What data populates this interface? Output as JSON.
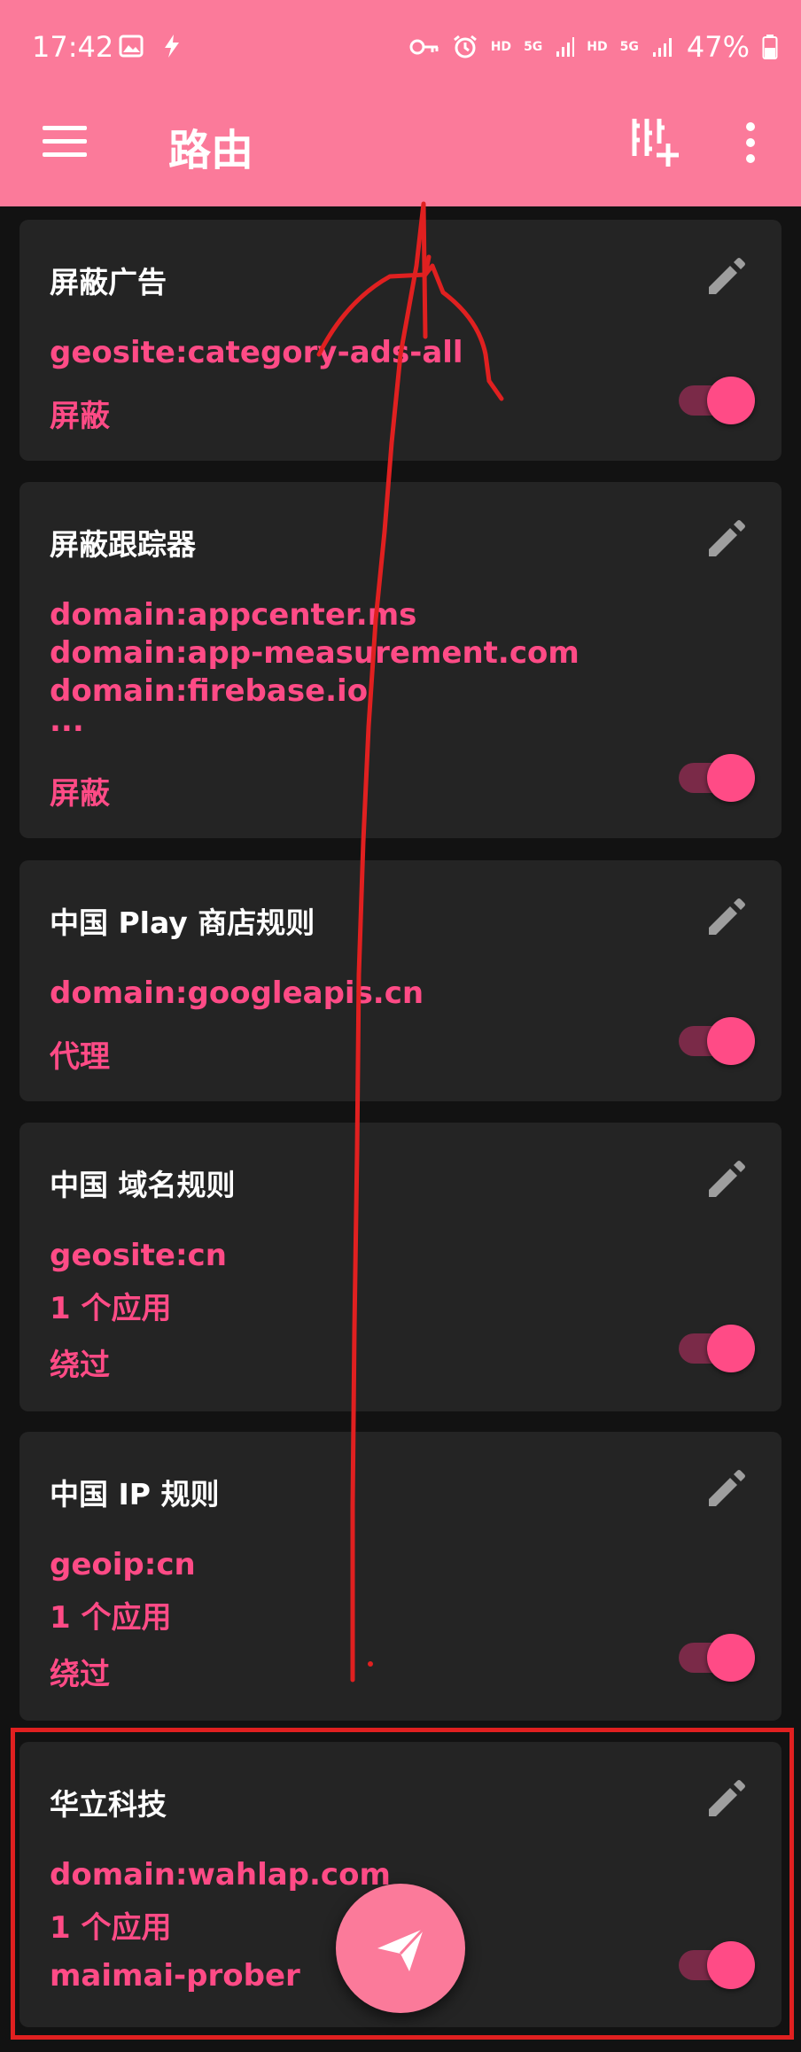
{
  "status_bar": {
    "time": "17:42",
    "battery": "47%",
    "network_labels": [
      "HD",
      "5G",
      "HD",
      "5G"
    ],
    "icons": [
      "image-icon",
      "bolt-icon",
      "key-icon",
      "alarm-icon",
      "signal-icon",
      "signal-icon",
      "battery-icon"
    ]
  },
  "app_bar": {
    "title": "路由",
    "icons": [
      "menu-icon",
      "add-column-icon",
      "more-vert-icon"
    ]
  },
  "colors": {
    "app_bar": "#fb7a9a",
    "background": "#121212",
    "card": "#242424",
    "accent": "#ff4b86",
    "annotation": "#e02020"
  },
  "rules": [
    {
      "title": "屏蔽广告",
      "lines": [
        "geosite:category-ads-all"
      ],
      "outbound": "屏蔽",
      "enabled": true
    },
    {
      "title": "屏蔽跟踪器",
      "lines": [
        "domain:appcenter.ms",
        "domain:app-measurement.com",
        "domain:firebase.io",
        "..."
      ],
      "outbound": "屏蔽",
      "enabled": true
    },
    {
      "title": "中国 Play 商店规则",
      "lines": [
        "domain:googleapis.cn"
      ],
      "outbound": "代理",
      "enabled": true
    },
    {
      "title": "中国 域名规则",
      "lines": [
        "geosite:cn",
        "1 个应用"
      ],
      "outbound": "绕过",
      "enabled": true
    },
    {
      "title": "中国 IP 规则",
      "lines": [
        "geoip:cn",
        "1 个应用"
      ],
      "outbound": "绕过",
      "enabled": true
    },
    {
      "title": "华立科技",
      "lines": [
        "domain:wahlap.com",
        "1 个应用"
      ],
      "outbound": "maimai-prober",
      "enabled": true
    }
  ],
  "fab": {
    "icon": "send-icon"
  }
}
